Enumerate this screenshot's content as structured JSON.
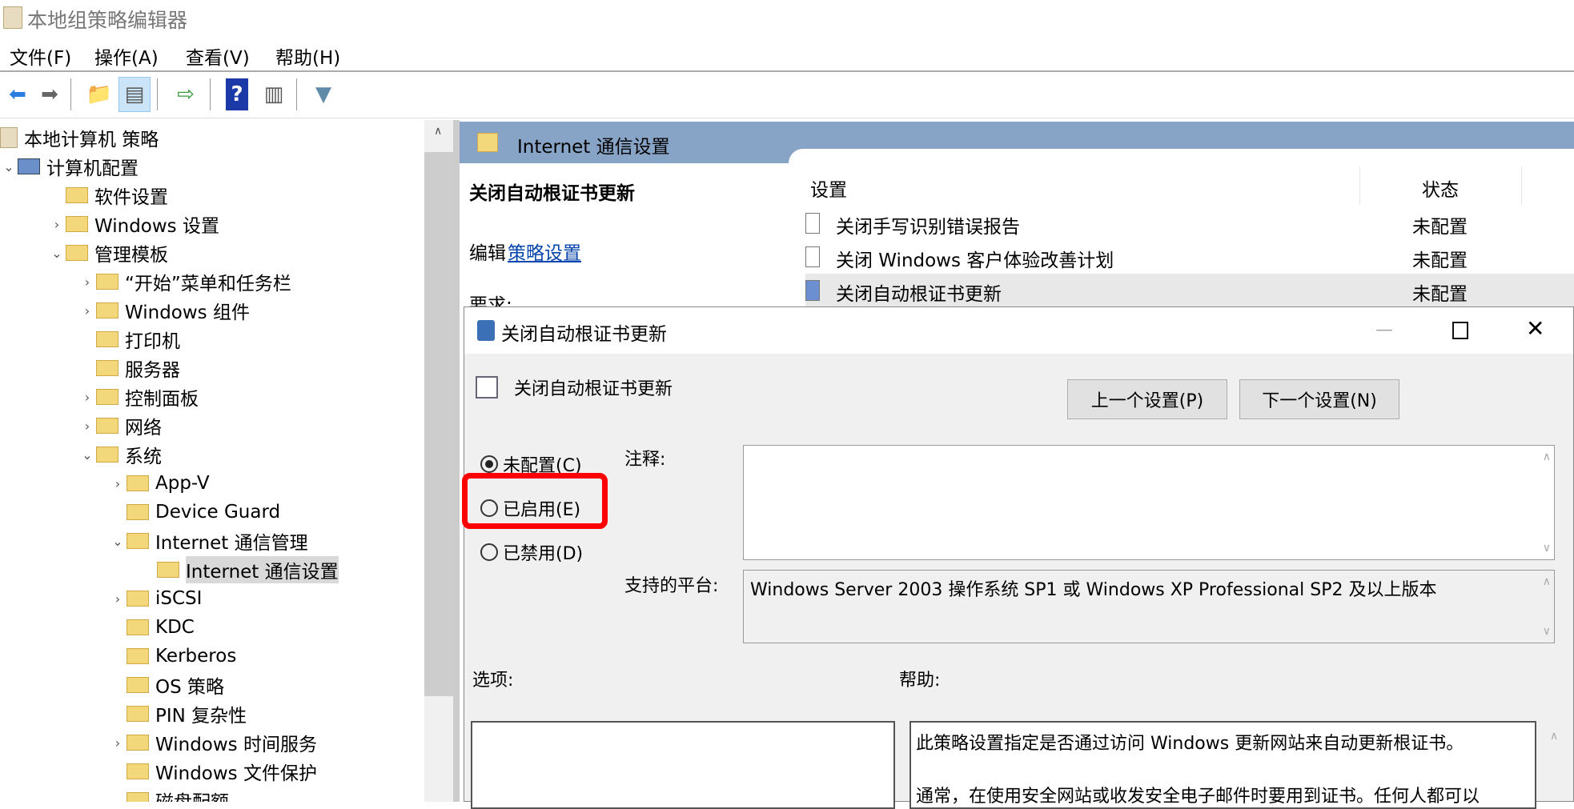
{
  "window": {
    "title": "本地组策略编辑器"
  },
  "menu": [
    "文件(F)",
    "操作(A)",
    "查看(V)",
    "帮助(H)"
  ],
  "toolbar": [
    "back-icon",
    "forward-icon",
    "up-folder-icon",
    "show-hide-tree-icon",
    "export-list-icon",
    "help-icon",
    "show-hide-action-pane-icon",
    "filter-icon"
  ],
  "tree": [
    {
      "label": "本地计算机 策略",
      "level": 0,
      "chev": "",
      "icon": "policy"
    },
    {
      "label": "计算机配置",
      "level": 0,
      "chev": "v",
      "icon": "computer"
    },
    {
      "label": "软件设置",
      "level": 1,
      "chev": ""
    },
    {
      "label": "Windows 设置",
      "level": 1,
      "chev": ">"
    },
    {
      "label": "管理模板",
      "level": 1,
      "chev": "v"
    },
    {
      "label": "“开始”菜单和任务栏",
      "level": 2,
      "chev": ">"
    },
    {
      "label": "Windows 组件",
      "level": 2,
      "chev": ">"
    },
    {
      "label": "打印机",
      "level": 2,
      "chev": ""
    },
    {
      "label": "服务器",
      "level": 2,
      "chev": ""
    },
    {
      "label": "控制面板",
      "level": 2,
      "chev": ">"
    },
    {
      "label": "网络",
      "level": 2,
      "chev": ">"
    },
    {
      "label": "系统",
      "level": 2,
      "chev": "v"
    },
    {
      "label": "App-V",
      "level": 3,
      "chev": ">"
    },
    {
      "label": "Device Guard",
      "level": 3,
      "chev": ""
    },
    {
      "label": "Internet 通信管理",
      "level": 3,
      "chev": "v"
    },
    {
      "label": "Internet 通信设置",
      "level": 4,
      "chev": "",
      "selected": true
    },
    {
      "label": "iSCSI",
      "level": 3,
      "chev": ">"
    },
    {
      "label": "KDC",
      "level": 3,
      "chev": ""
    },
    {
      "label": "Kerberos",
      "level": 3,
      "chev": ""
    },
    {
      "label": "OS 策略",
      "level": 3,
      "chev": ""
    },
    {
      "label": "PIN 复杂性",
      "level": 3,
      "chev": ""
    },
    {
      "label": "Windows 时间服务",
      "level": 3,
      "chev": ">"
    },
    {
      "label": "Windows 文件保护",
      "level": 3,
      "chev": ""
    },
    {
      "label": "磁盘配额",
      "level": 3,
      "chev": ""
    }
  ],
  "right": {
    "header": "Internet 通信设置",
    "detail_title": "关闭自动根证书更新",
    "edit_prefix": "编辑",
    "edit_link": "策略设置",
    "requirements": "要求:",
    "columns": [
      "设置",
      "状态"
    ],
    "rows": [
      {
        "name": "关闭手写识别错误报告",
        "state": "未配置"
      },
      {
        "name": "关闭 Windows 客户体验改善计划",
        "state": "未配置"
      },
      {
        "name": "关闭自动根证书更新",
        "state": "未配置",
        "selected": true
      }
    ]
  },
  "dialog": {
    "title": "关闭自动根证书更新",
    "heading": "关闭自动根证书更新",
    "prev": "上一个设置(P)",
    "next": "下一个设置(N)",
    "radios": [
      {
        "label": "未配置(C)",
        "checked": true
      },
      {
        "label": "已启用(E)",
        "checked": false
      },
      {
        "label": "已禁用(D)",
        "checked": false
      }
    ],
    "comment_label": "注释:",
    "comment_value": "",
    "platform_label": "支持的平台:",
    "platform_value": "Windows Server 2003 操作系统 SP1 或 Windows XP Professional SP2 及以上版本",
    "options_label": "选项:",
    "help_label": "帮助:",
    "help_text": [
      "此策略设置指定是否通过访问 Windows 更新网站来自动更新根证书。",
      "通常，在使用安全网站或收发安全电子邮件时要用到证书。任何人都可以"
    ],
    "highlight_color": "#ff0000"
  }
}
